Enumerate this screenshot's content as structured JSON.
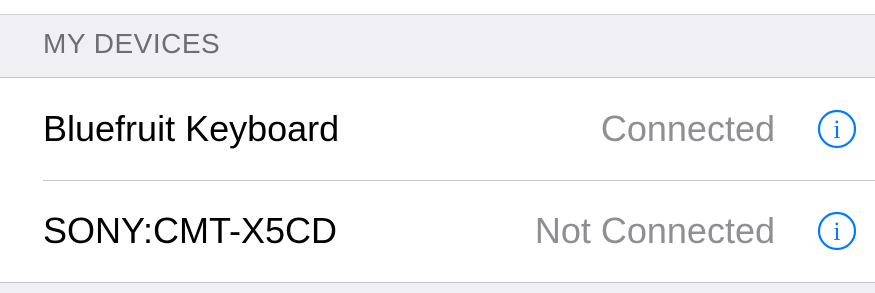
{
  "section": {
    "title": "MY DEVICES"
  },
  "devices": [
    {
      "name": "Bluefruit Keyboard",
      "status": "Connected"
    },
    {
      "name": "SONY:CMT-X5CD",
      "status": "Not Connected"
    }
  ],
  "icons": {
    "info": "info-icon"
  },
  "colors": {
    "accent": "#007aff",
    "status_text": "#8e8e93",
    "header_text": "#6d6d72",
    "background": "#efeff4"
  }
}
